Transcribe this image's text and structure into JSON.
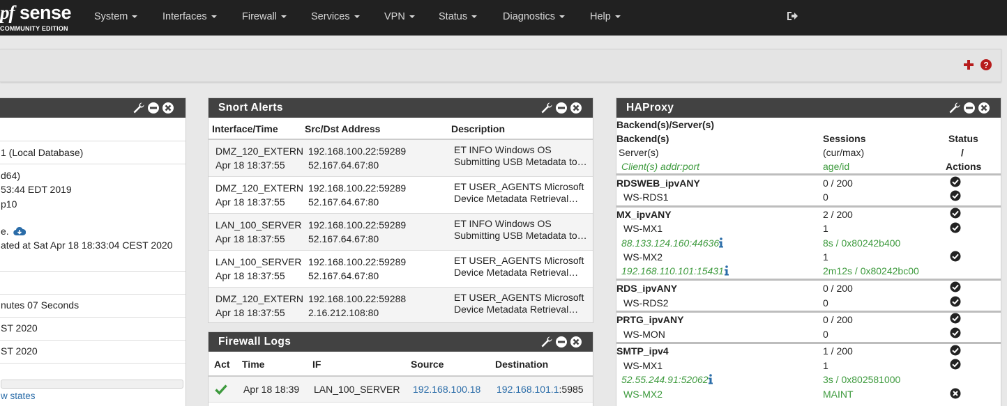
{
  "navbar": {
    "logo_pf": "pf",
    "logo_sense": "sense",
    "logo_edition": "COMMUNITY EDITION",
    "menu": [
      "System",
      "Interfaces",
      "Firewall",
      "Services",
      "VPN",
      "Status",
      "Diagnostics",
      "Help"
    ]
  },
  "left_panel": {
    "lines": [
      "1 (Local Database)",
      "d64)",
      "53:44 EDT 2019",
      "p10",
      "e.",
      "ated at Sat Apr 18 18:33:04 CEST 2020",
      "nutes 07 Seconds",
      "ST 2020",
      "ST 2020",
      "w states"
    ]
  },
  "snort": {
    "title": "Snort Alerts",
    "headers": [
      "Interface/Time",
      "Src/Dst Address",
      "Description"
    ],
    "rows": [
      {
        "iface": "DMZ_120_EXTERN",
        "time": "Apr 18 18:37:55",
        "src": "192.168.100.22:59289",
        "dst": "52.167.64.67:80",
        "desc1": "ET INFO Windows OS",
        "desc2": "Submitting USB Metadata to…"
      },
      {
        "iface": "DMZ_120_EXTERN",
        "time": "Apr 18 18:37:55",
        "src": "192.168.100.22:59289",
        "dst": "52.167.64.67:80",
        "desc1": "ET USER_AGENTS Microsoft",
        "desc2": "Device Metadata Retrieval…"
      },
      {
        "iface": "LAN_100_SERVER",
        "time": "Apr 18 18:37:55",
        "src": "192.168.100.22:59289",
        "dst": "52.167.64.67:80",
        "desc1": "ET INFO Windows OS",
        "desc2": "Submitting USB Metadata to…"
      },
      {
        "iface": "LAN_100_SERVER",
        "time": "Apr 18 18:37:55",
        "src": "192.168.100.22:59289",
        "dst": "52.167.64.67:80",
        "desc1": "ET USER_AGENTS Microsoft",
        "desc2": "Device Metadata Retrieval…"
      },
      {
        "iface": "DMZ_120_EXTERN",
        "time": "Apr 18 18:37:55",
        "src": "192.168.100.22:59288",
        "dst": "2.16.212.108:80",
        "desc1": "ET USER_AGENTS Microsoft",
        "desc2": "Device Metadata Retrieval…"
      }
    ]
  },
  "fwlogs": {
    "title": "Firewall Logs",
    "headers": [
      "Act",
      "Time",
      "IF",
      "Source",
      "Destination"
    ],
    "rows": [
      {
        "time": "Apr 18 18:39",
        "iface": "LAN_100_SERVER",
        "source": "192.168.100.18",
        "dest_ip": "192.168.101.1",
        "dest_port": ":5985"
      }
    ]
  },
  "haproxy": {
    "title": "HAProxy",
    "top_label": "Backend(s)/Server(s)",
    "h_backend": "Backend(s)",
    "h_server": "Server(s)",
    "h_client": "Client(s) addr:port",
    "h_sessions": "Sessions",
    "h_curmax": "(cur/max)",
    "h_ageid": "age/id",
    "h_status": "Status",
    "h_slash": "/",
    "h_actions": "Actions",
    "rows": [
      {
        "name": "RDSWEB_ipvANY",
        "sess": "0 / 200"
      },
      {
        "name": "WS-RDS1",
        "sess": "0"
      },
      {
        "name": "MX_ipvANY",
        "sess": "2 / 200"
      },
      {
        "name": "WS-MX1",
        "sess": "1"
      },
      {
        "name": "88.133.124.160:44636",
        "sess": "8s / 0x80242b400"
      },
      {
        "name": "WS-MX2",
        "sess": "1"
      },
      {
        "name": "192.168.110.101:15431",
        "sess": "2m12s / 0x80242bc00"
      },
      {
        "name": "RDS_ipvANY",
        "sess": "0 / 200"
      },
      {
        "name": "WS-RDS2",
        "sess": "0"
      },
      {
        "name": "PRTG_ipvANY",
        "sess": "0 / 200"
      },
      {
        "name": "WS-MON",
        "sess": "0"
      },
      {
        "name": "SMTP_ipv4",
        "sess": "1 / 200"
      },
      {
        "name": "WS-MX1",
        "sess": "1"
      },
      {
        "name": "52.55.244.91:52062",
        "sess": "3s / 0x802581000"
      },
      {
        "name": "WS-MX2",
        "sess": "MAINT"
      }
    ]
  },
  "colors": {
    "navbar": "#212121",
    "panel_head": "#424242",
    "accent_red": "#b71c1c",
    "link": "#2a6ca8",
    "green": "#3d9a3d"
  }
}
